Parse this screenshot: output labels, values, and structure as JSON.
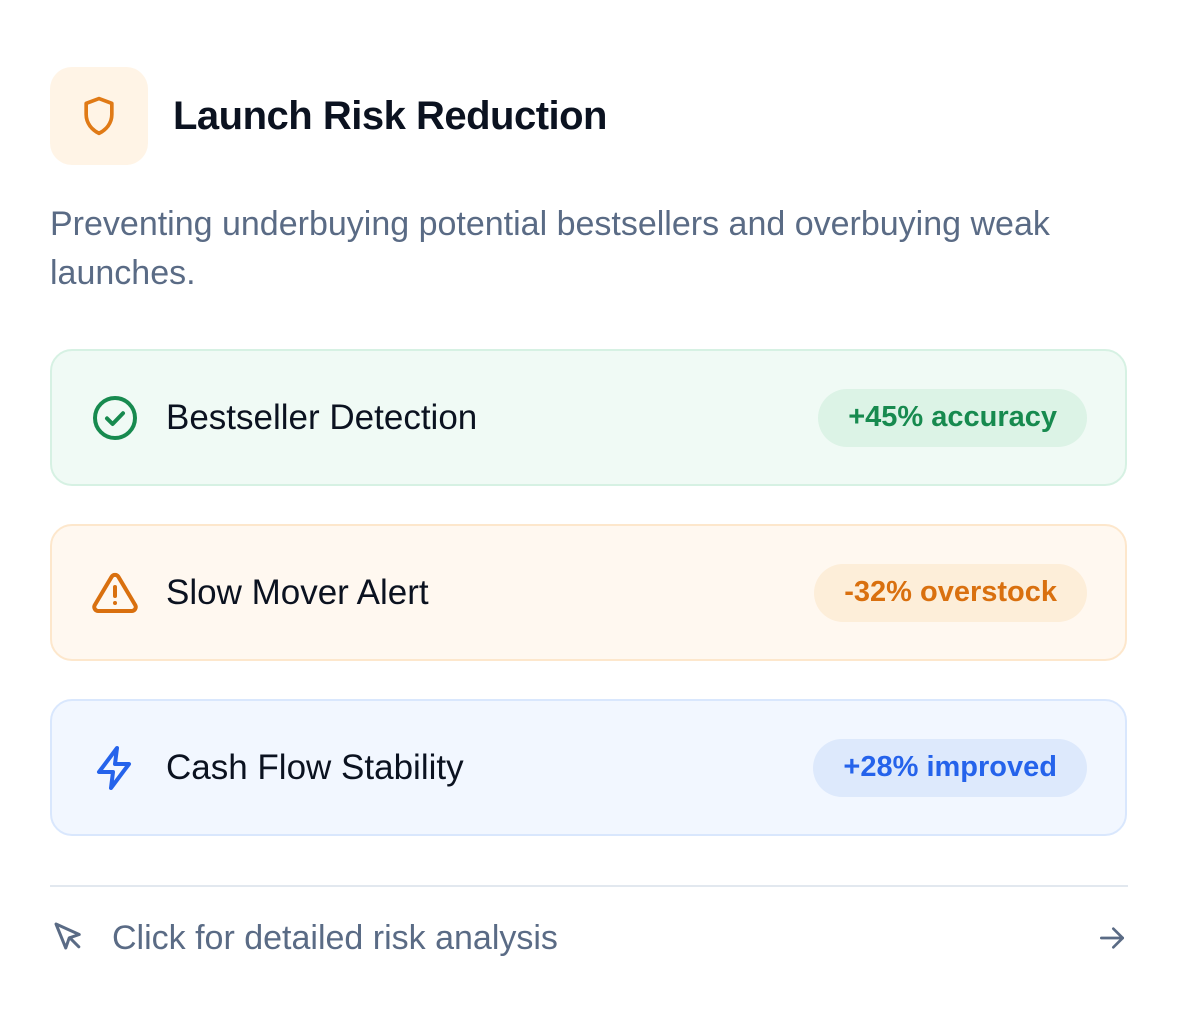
{
  "header": {
    "title": "Launch Risk Reduction",
    "icon": "shield-icon",
    "icon_color": "#e07a16",
    "icon_bg": "#fff4e6"
  },
  "description": "Preventing underbuying potential bestsellers and overbuying weak launches.",
  "metrics": [
    {
      "label": "Bestseller Detection",
      "badge": "+45% accuracy",
      "icon": "check-circle-icon",
      "accent": "#178a4f"
    },
    {
      "label": "Slow Mover Alert",
      "badge": "-32% overstock",
      "icon": "warning-triangle-icon",
      "accent": "#d9700f"
    },
    {
      "label": "Cash Flow Stability",
      "badge": "+28% improved",
      "icon": "lightning-icon",
      "accent": "#2563eb"
    }
  ],
  "footer": {
    "text": "Click for detailed risk analysis",
    "cursor_icon": "cursor-pointer-icon",
    "arrow_icon": "arrow-right-icon"
  }
}
